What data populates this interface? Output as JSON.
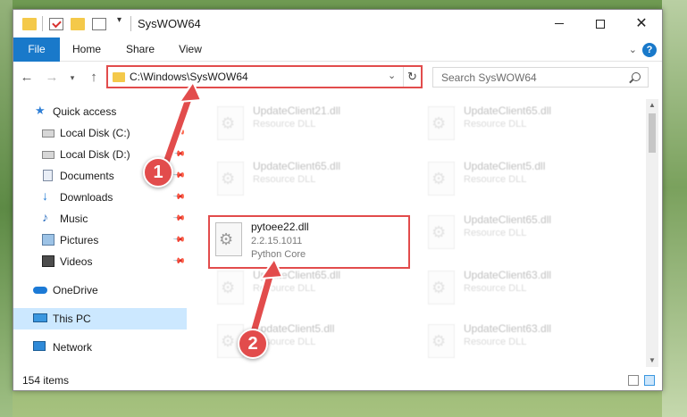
{
  "window": {
    "title": "SysWOW64",
    "quick_access_menu": "▾",
    "minimize": "",
    "maximize": "",
    "close": "✕"
  },
  "ribbon": {
    "tabs": [
      "File",
      "Home",
      "Share",
      "View"
    ],
    "expand": "⌄",
    "help": "?"
  },
  "address_bar": {
    "back": "←",
    "forward": "→",
    "recent": "▾",
    "up": "↑",
    "path": "C:\\Windows\\SysWOW64",
    "dropdown": "⌄",
    "refresh": "↻",
    "search_placeholder": "Search SysWOW64"
  },
  "navigation": {
    "items": [
      {
        "label": "Quick access",
        "icon": "star-icon",
        "pinned": false
      },
      {
        "label": "Local Disk (C:)",
        "icon": "drive-icon",
        "pinned": true
      },
      {
        "label": "Local Disk (D:)",
        "icon": "drive-icon",
        "pinned": true
      },
      {
        "label": "Documents",
        "icon": "documents-icon",
        "pinned": true
      },
      {
        "label": "Downloads",
        "icon": "download-icon",
        "pinned": true
      },
      {
        "label": "Music",
        "icon": "music-icon",
        "pinned": true
      },
      {
        "label": "Pictures",
        "icon": "pictures-icon",
        "pinned": true
      },
      {
        "label": "Videos",
        "icon": "videos-icon",
        "pinned": true
      },
      {
        "label": "OneDrive",
        "icon": "cloud-icon",
        "pinned": false
      },
      {
        "label": "This PC",
        "icon": "computer-icon",
        "pinned": false,
        "selected": true
      },
      {
        "label": "Network",
        "icon": "network-icon",
        "pinned": false
      }
    ],
    "pin_glyph": "📌"
  },
  "files": {
    "highlighted": {
      "name": "pytoee22.dll",
      "version": "2.2.15.1011",
      "description": "Python Core"
    },
    "background_tiles": [
      {
        "name": "UpdateClient21.dll",
        "type": "Resource DLL"
      },
      {
        "name": "UpdateClient65.dll",
        "type": "Resource DLL"
      },
      {
        "name": "UpdateClient65.dll",
        "type": "Resource DLL"
      },
      {
        "name": "UpdateClient5.dll",
        "type": "Resource DLL"
      },
      {
        "name": "UpdateClient65.dll",
        "type": "Resource DLL"
      },
      {
        "name": "UpdateClient65.dll",
        "type": "Resource DLL"
      },
      {
        "name": "UpdateClient63.dll",
        "type": "Resource DLL"
      },
      {
        "name": "UpdateClient5.dll",
        "type": "Resource DLL"
      },
      {
        "name": "UpdateClient63.dll",
        "type": "Resource DLL"
      }
    ]
  },
  "scrollbar": {
    "up": "▲",
    "down": "▼"
  },
  "status": {
    "item_count": "154 items"
  },
  "annotations": {
    "step1": "1",
    "step2": "2",
    "color": "#e24c4c"
  }
}
